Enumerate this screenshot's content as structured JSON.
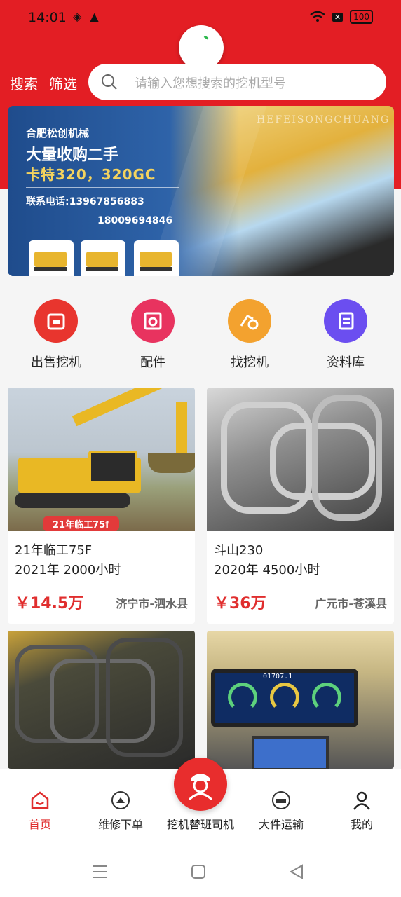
{
  "status_bar": {
    "time": "14:01",
    "left_icons": [
      "location-icon",
      "alert-icon"
    ],
    "right_icons": [
      "wifi-icon",
      "sim-off-icon"
    ],
    "battery": "100"
  },
  "search": {
    "search_label": "搜索",
    "filter_label": "筛选",
    "placeholder": "请输入您想搜索的挖机型号"
  },
  "banner": {
    "brand": "HEFEISONGCHUANG",
    "company": "合肥松创机械",
    "headline": "大量收购二手",
    "models": "卡特320，320GC",
    "phone_line1": "联系电话:13967856883",
    "phone_line2": "18009694846"
  },
  "categories": [
    {
      "label": "出售挖机",
      "icon": "sell-icon",
      "color": "#e8352e"
    },
    {
      "label": "配件",
      "icon": "parts-icon",
      "color": "#e8335f"
    },
    {
      "label": "找挖机",
      "icon": "find-excavator-icon",
      "color": "#f3a22f"
    },
    {
      "label": "资料库",
      "icon": "library-icon",
      "color": "#6b4ef0"
    }
  ],
  "listings": [
    {
      "image_caption": "21年临工75f",
      "title": "21年临工75F",
      "specs": "2021年 2000小时",
      "price": "￥14.5万",
      "location": "济宁市-泗水县"
    },
    {
      "title": "斗山230",
      "specs": "2020年 4500小时",
      "price": "￥36万",
      "location": "广元市-苍溪县"
    },
    {
      "monitor_reading": "01707.1"
    }
  ],
  "bottom_nav": {
    "home": "首页",
    "repair": "维修下单",
    "driver": "挖机替班司机",
    "transport": "大件运输",
    "mine": "我的"
  },
  "colors": {
    "brand_red": "#e31e24",
    "price_red": "#e02e2e"
  }
}
